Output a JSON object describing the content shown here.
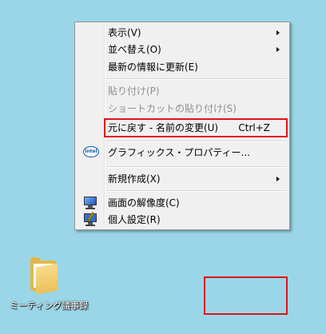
{
  "context_menu": {
    "items": [
      {
        "label": "表示(V)",
        "submenu": true,
        "disabled": false
      },
      {
        "label": "並べ替え(O)",
        "submenu": true,
        "disabled": false
      },
      {
        "label": "最新の情報に更新(E)",
        "submenu": false,
        "disabled": false
      },
      {
        "label": "貼り付け(P)",
        "submenu": false,
        "disabled": true
      },
      {
        "label": "ショートカットの貼り付け(S)",
        "submenu": false,
        "disabled": true
      },
      {
        "label": "元に戻す - 名前の変更(U)",
        "shortcut": "Ctrl+Z",
        "submenu": false,
        "disabled": false,
        "highlighted": true
      },
      {
        "label": "グラフィックス・プロパティー...",
        "icon": "intel-graphics-icon",
        "submenu": false,
        "disabled": false
      },
      {
        "label": "新規作成(X)",
        "submenu": true,
        "disabled": false
      },
      {
        "label": "画面の解像度(C)",
        "icon": "screen-resolution-icon",
        "submenu": false,
        "disabled": false
      },
      {
        "label": "個人設定(R)",
        "icon": "personalize-icon",
        "submenu": false,
        "disabled": false
      }
    ],
    "intel_logo_text": "intel"
  },
  "desktop": {
    "folder_label": "ミーティング議事録"
  },
  "colors": {
    "desktop_bg": "#9ad6e8",
    "highlight_border": "#e1121a"
  }
}
